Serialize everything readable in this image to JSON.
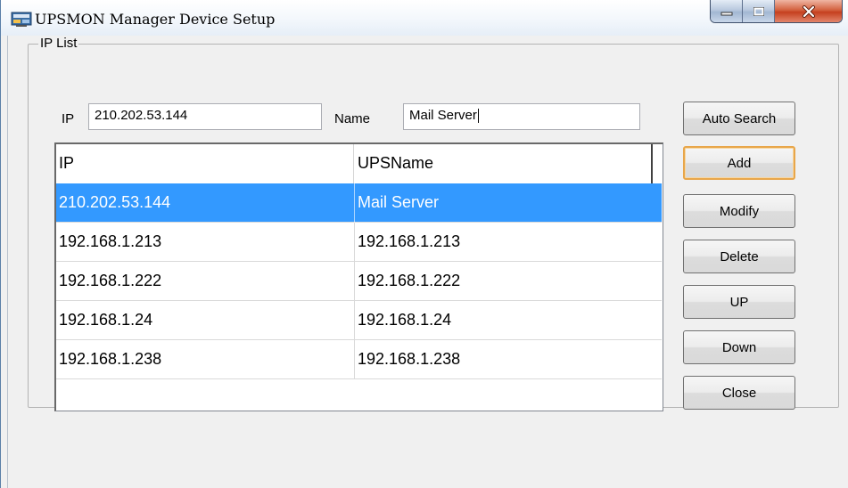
{
  "window": {
    "title": "UPSMON Manager Device Setup",
    "controls": {
      "minimize": "minimize-icon",
      "maximize": "maximize-icon",
      "close": "close-icon"
    }
  },
  "group": {
    "label": "IP List"
  },
  "form": {
    "ip_label": "IP",
    "ip_value": "210.202.53.144",
    "name_label": "Name",
    "name_value": "Mail Server"
  },
  "list": {
    "columns": [
      "IP",
      "UPSName"
    ],
    "rows": [
      {
        "ip": "210.202.53.144",
        "name": "Mail Server",
        "selected": true
      },
      {
        "ip": "192.168.1.213",
        "name": "192.168.1.213"
      },
      {
        "ip": "192.168.1.222",
        "name": "192.168.1.222"
      },
      {
        "ip": "192.168.1.24",
        "name": "192.168.1.24"
      },
      {
        "ip": "192.168.1.238",
        "name": "192.168.1.238"
      }
    ]
  },
  "buttons": {
    "auto_search": "Auto Search",
    "add": "Add",
    "modify": "Modify",
    "delete": "Delete",
    "up": "UP",
    "down": "Down",
    "close": "Close"
  },
  "colors": {
    "selection": "#3399ff",
    "default_button_border": "#e8a64a",
    "close_button": "#c5401f"
  }
}
